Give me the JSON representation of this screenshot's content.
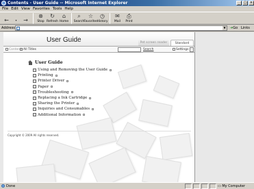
{
  "window": {
    "title": "Contents - User Guide -- Microsoft Internet Explorer"
  },
  "menu": {
    "items": [
      "File",
      "Edit",
      "View",
      "Favorites",
      "Tools",
      "Help"
    ]
  },
  "toolbar": {
    "buttons": [
      {
        "label": "",
        "icon": "back-arrow-icon"
      },
      {
        "label": "",
        "icon": "forward-arrow-icon"
      },
      {
        "label": "Stop",
        "icon": "stop-icon"
      },
      {
        "label": "Refresh",
        "icon": "refresh-icon"
      },
      {
        "label": "Home",
        "icon": "home-icon"
      },
      {
        "label": "Search",
        "icon": "search-icon"
      },
      {
        "label": "Favorites",
        "icon": "favorites-icon"
      },
      {
        "label": "History",
        "icon": "history-icon"
      },
      {
        "label": "Mail",
        "icon": "mail-icon"
      },
      {
        "label": "Print",
        "icon": "print-icon"
      }
    ]
  },
  "address": {
    "label": "Address",
    "value": "",
    "go_label": "Go",
    "links_label": "Links"
  },
  "doc": {
    "title": "User Guide",
    "view_tabs": [
      "Pet screen reader",
      "Standard"
    ],
    "nav": {
      "contents": "Contents",
      "all_titles": "All Titles",
      "search_button": "Search",
      "settings": "Settings"
    },
    "toc_heading": "User Guide",
    "toc_items": [
      "Using and Removing the User Guide",
      "Printing",
      "Printer Driver",
      "Paper",
      "Troubleshooting",
      "Replacing a Ink Cartridge",
      "Sharing the Printer",
      "Inquiries and Consumables",
      "Additional Information"
    ],
    "copyright": "Copyright © 2009 All rights reserved."
  },
  "status": {
    "text": "Done",
    "zone": "My Computer"
  },
  "colors": {
    "titlebar": "#0a246a",
    "chrome": "#d4d0c8"
  }
}
